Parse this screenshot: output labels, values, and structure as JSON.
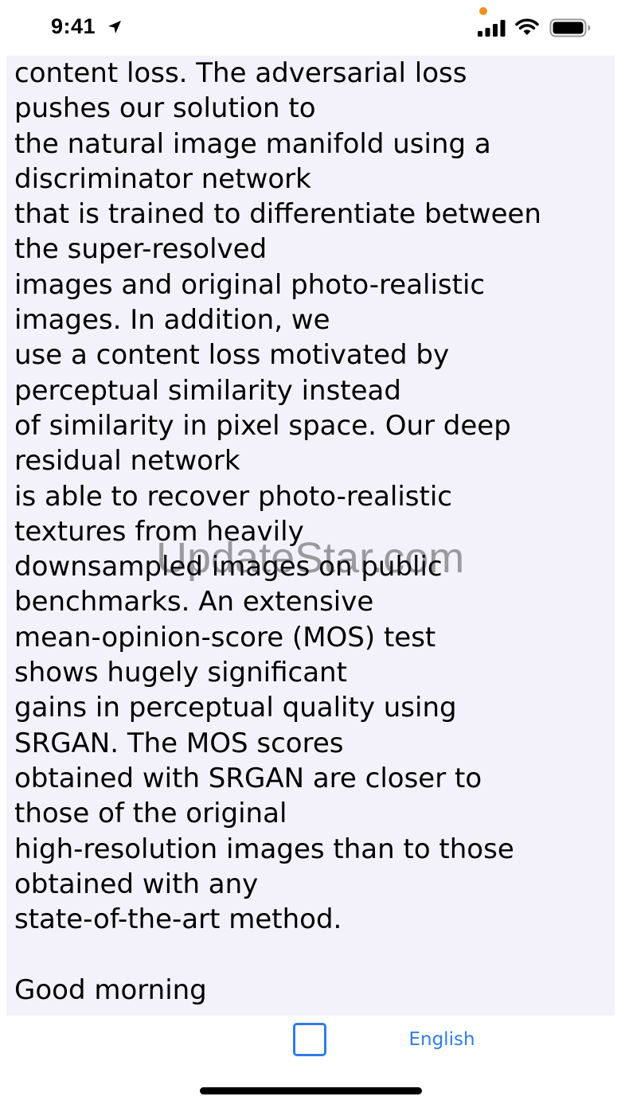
{
  "status_bar": {
    "time": "9:41",
    "privacy_dot_color": "#f0901c",
    "icons": [
      "location-arrow-icon",
      "cellular-signal-icon",
      "wifi-icon",
      "battery-icon"
    ]
  },
  "content": {
    "background_color": "#f3f2fa",
    "text": "content loss. The adversarial loss\npushes our solution to\nthe natural image manifold using a\ndiscriminator network\nthat is trained to differentiate between\nthe super-resolved\nimages and original photo-realistic\nimages. In addition, we\nuse a content loss motivated by\nperceptual similarity instead\nof similarity in pixel space. Our deep\nresidual network\nis able to recover photo-realistic\ntextures from heavily\ndownsampled images on public\nbenchmarks. An extensive\nmean-opinion-score (MOS) test\nshows hugely significant\ngains in perceptual quality using\nSRGAN. The MOS scores\nobtained with SRGAN are closer to\nthose of the original\nhigh-resolution images than to those\nobtained with any\nstate-of-the-art method.\n\nGood morning",
    "watermark": "UpdateStar.com"
  },
  "toolbar": {
    "square_button_icon": "square-outline-icon",
    "language_label": "English",
    "accent_color": "#2f7ce8"
  }
}
